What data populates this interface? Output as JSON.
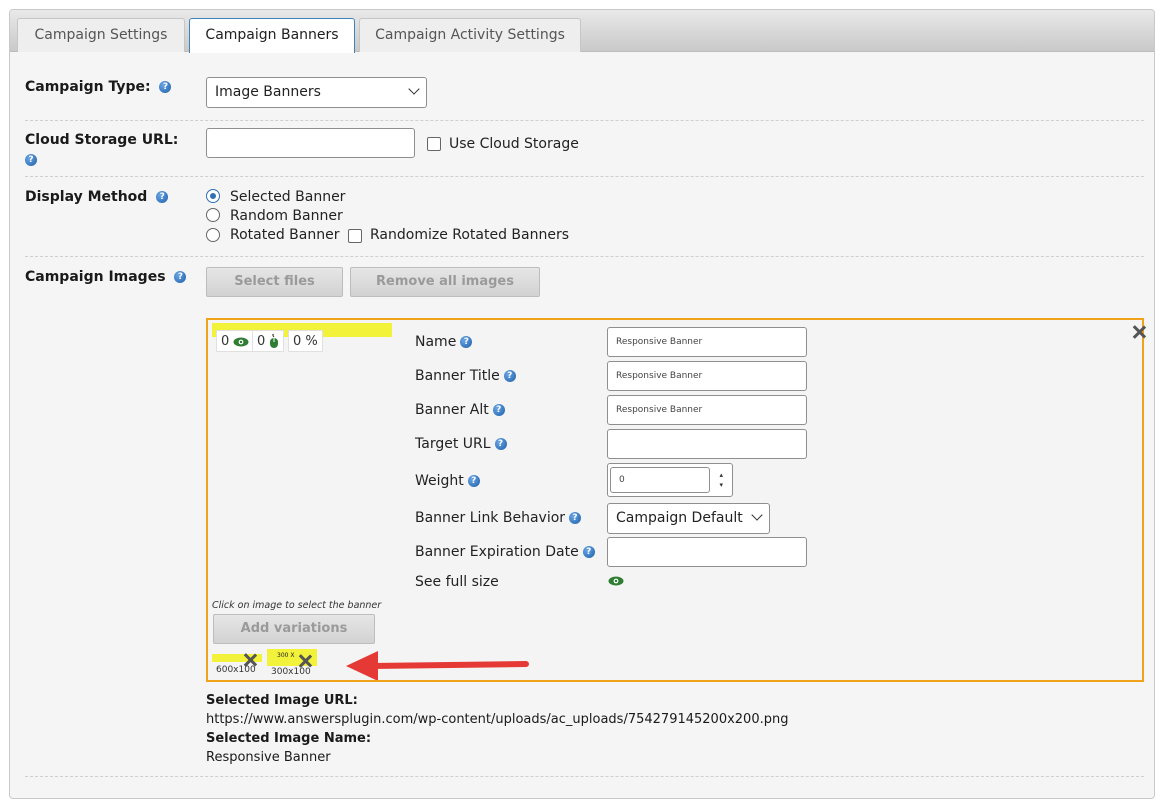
{
  "tabs": [
    {
      "label": "Campaign Settings"
    },
    {
      "label": "Campaign Banners"
    },
    {
      "label": "Campaign Activity Settings"
    }
  ],
  "campaign_type": {
    "label": "Campaign Type:",
    "value": "Image Banners"
  },
  "cloud_storage": {
    "label": "Cloud Storage URL:",
    "value": "",
    "checkbox_label": "Use Cloud Storage"
  },
  "display_method": {
    "label": "Display Method",
    "options": [
      {
        "label": "Selected Banner",
        "checked": true
      },
      {
        "label": "Random Banner",
        "checked": false
      },
      {
        "label": "Rotated Banner",
        "checked": false
      }
    ],
    "randomize_label": "Randomize Rotated Banners"
  },
  "campaign_images": {
    "label": "Campaign Images",
    "select_files": "Select files",
    "remove_all": "Remove all images"
  },
  "banner": {
    "stats": {
      "views": "0",
      "clicks": "0",
      "ctr": "0 %"
    },
    "hint": "Click on image to select the banner",
    "add_variations": "Add variations",
    "thumbnails": [
      {
        "caption": "600x100"
      },
      {
        "caption": "300x100",
        "text": "300 X"
      }
    ],
    "fields": {
      "name_label": "Name",
      "name_value": "Responsive Banner",
      "title_label": "Banner Title",
      "title_value": "Responsive Banner",
      "alt_label": "Banner Alt",
      "alt_value": "Responsive Banner",
      "target_label": "Target URL",
      "target_value": "",
      "weight_label": "Weight",
      "weight_value": "0",
      "link_label": "Banner Link Behavior",
      "link_value": "Campaign Default",
      "expiration_label": "Banner Expiration Date",
      "expiration_value": "",
      "full_size_label": "See full size"
    }
  },
  "selected_image": {
    "url_label": "Selected Image URL:",
    "url": "https://www.answersplugin.com/wp-content/uploads/ac_uploads/754279145200x200.png",
    "name_label": "Selected Image Name:",
    "name": "Responsive Banner"
  },
  "colors": {
    "banner_border": "#f0a21a",
    "highlight": "#f2f23a",
    "arrow": "#e53935",
    "eye_green": "#2e7d32",
    "tab_active_border": "#3f83b8"
  }
}
